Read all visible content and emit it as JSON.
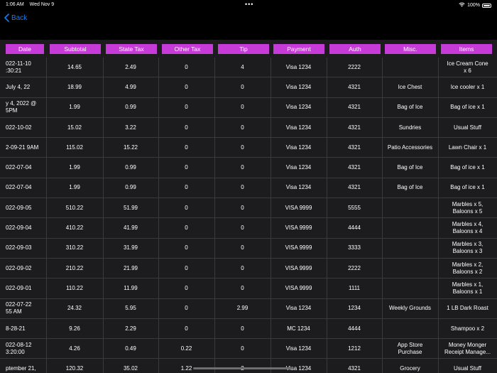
{
  "status": {
    "time": "1:06 AM",
    "date": "Wed Nov 9",
    "battery": "100%"
  },
  "nav": {
    "back_label": "Back"
  },
  "table": {
    "columns": [
      "Date",
      "Subtotal",
      "State Tax",
      "Other Tax",
      "Tip",
      "Payment",
      "Auth",
      "Misc.",
      "Items"
    ],
    "rows": [
      [
        "022-11-10\n:30:21",
        "14.65",
        "2.49",
        "0",
        "4",
        "Visa 1234",
        "2222",
        "",
        "Ice Cream Cone\nx 6"
      ],
      [
        "July 4, 22",
        "18.99",
        "4.99",
        "0",
        "0",
        "Visa 1234",
        "4321",
        "Ice Chest",
        "Ice cooler x 1"
      ],
      [
        "y 4, 2022 @\n5PM",
        "1.99",
        "0.99",
        "0",
        "0",
        "Visa 1234",
        "4321",
        "Bag of Ice",
        "Bag of ice x 1"
      ],
      [
        "022-10-02",
        "15.02",
        "3.22",
        "0",
        "0",
        "Visa 1234",
        "4321",
        "Sundries",
        "Usual Stuff"
      ],
      [
        "2-09-21 9AM",
        "115.02",
        "15.22",
        "0",
        "0",
        "Visa 1234",
        "4321",
        "Patio Accessories",
        "Lawn Chair x 1"
      ],
      [
        "022-07-04",
        "1.99",
        "0.99",
        "0",
        "0",
        "Visa 1234",
        "4321",
        "Bag of Ice",
        "Bag of ice x 1"
      ],
      [
        "022-07-04",
        "1.99",
        "0.99",
        "0",
        "0",
        "Visa 1234",
        "4321",
        "Bag of Ice",
        "Bag of ice x 1"
      ],
      [
        "022-09-05",
        "510.22",
        "51.99",
        "0",
        "0",
        "VISA 9999",
        "5555",
        "",
        "Marbles x 5,\nBaloons x 5"
      ],
      [
        "022-09-04",
        "410.22",
        "41.99",
        "0",
        "0",
        "VISA 9999",
        "4444",
        "",
        "Marbles x 4,\nBaloons x 4"
      ],
      [
        "022-09-03",
        "310.22",
        "31.99",
        "0",
        "0",
        "VISA 9999",
        "3333",
        "",
        "Marbles x 3,\nBaloons x 3"
      ],
      [
        "022-09-02",
        "210.22",
        "21.99",
        "0",
        "0",
        "VISA 9999",
        "2222",
        "",
        "Marbles x 2,\nBaloons x 2"
      ],
      [
        "022-09-01",
        "110.22",
        "11.99",
        "0",
        "0",
        "VISA 9999",
        "1111",
        "",
        "Marbles x 1,\nBaloons x 1"
      ],
      [
        "022-07-22\n55 AM",
        "24.32",
        "5.95",
        "0",
        "2.99",
        "Visa 1234",
        "1234",
        "Weekly Grounds",
        "1 LB Dark Roast"
      ],
      [
        "8-28-21",
        "9.26",
        "2.29",
        "0",
        "0",
        "MC 1234",
        "4444",
        "",
        "Shampoo x 2"
      ],
      [
        "022-08-12\n3:20:00",
        "4.26",
        "0.49",
        "0.22",
        "0",
        "Visa 1234",
        "1212",
        "App Store\nPurchase",
        "Money Monger\nReceipt Manage..."
      ],
      [
        "ptember 21,",
        "120.32",
        "35.02",
        "1.22",
        "2",
        "Visa 1234",
        "4321",
        "Grocery",
        "Usual Stuff"
      ]
    ]
  }
}
